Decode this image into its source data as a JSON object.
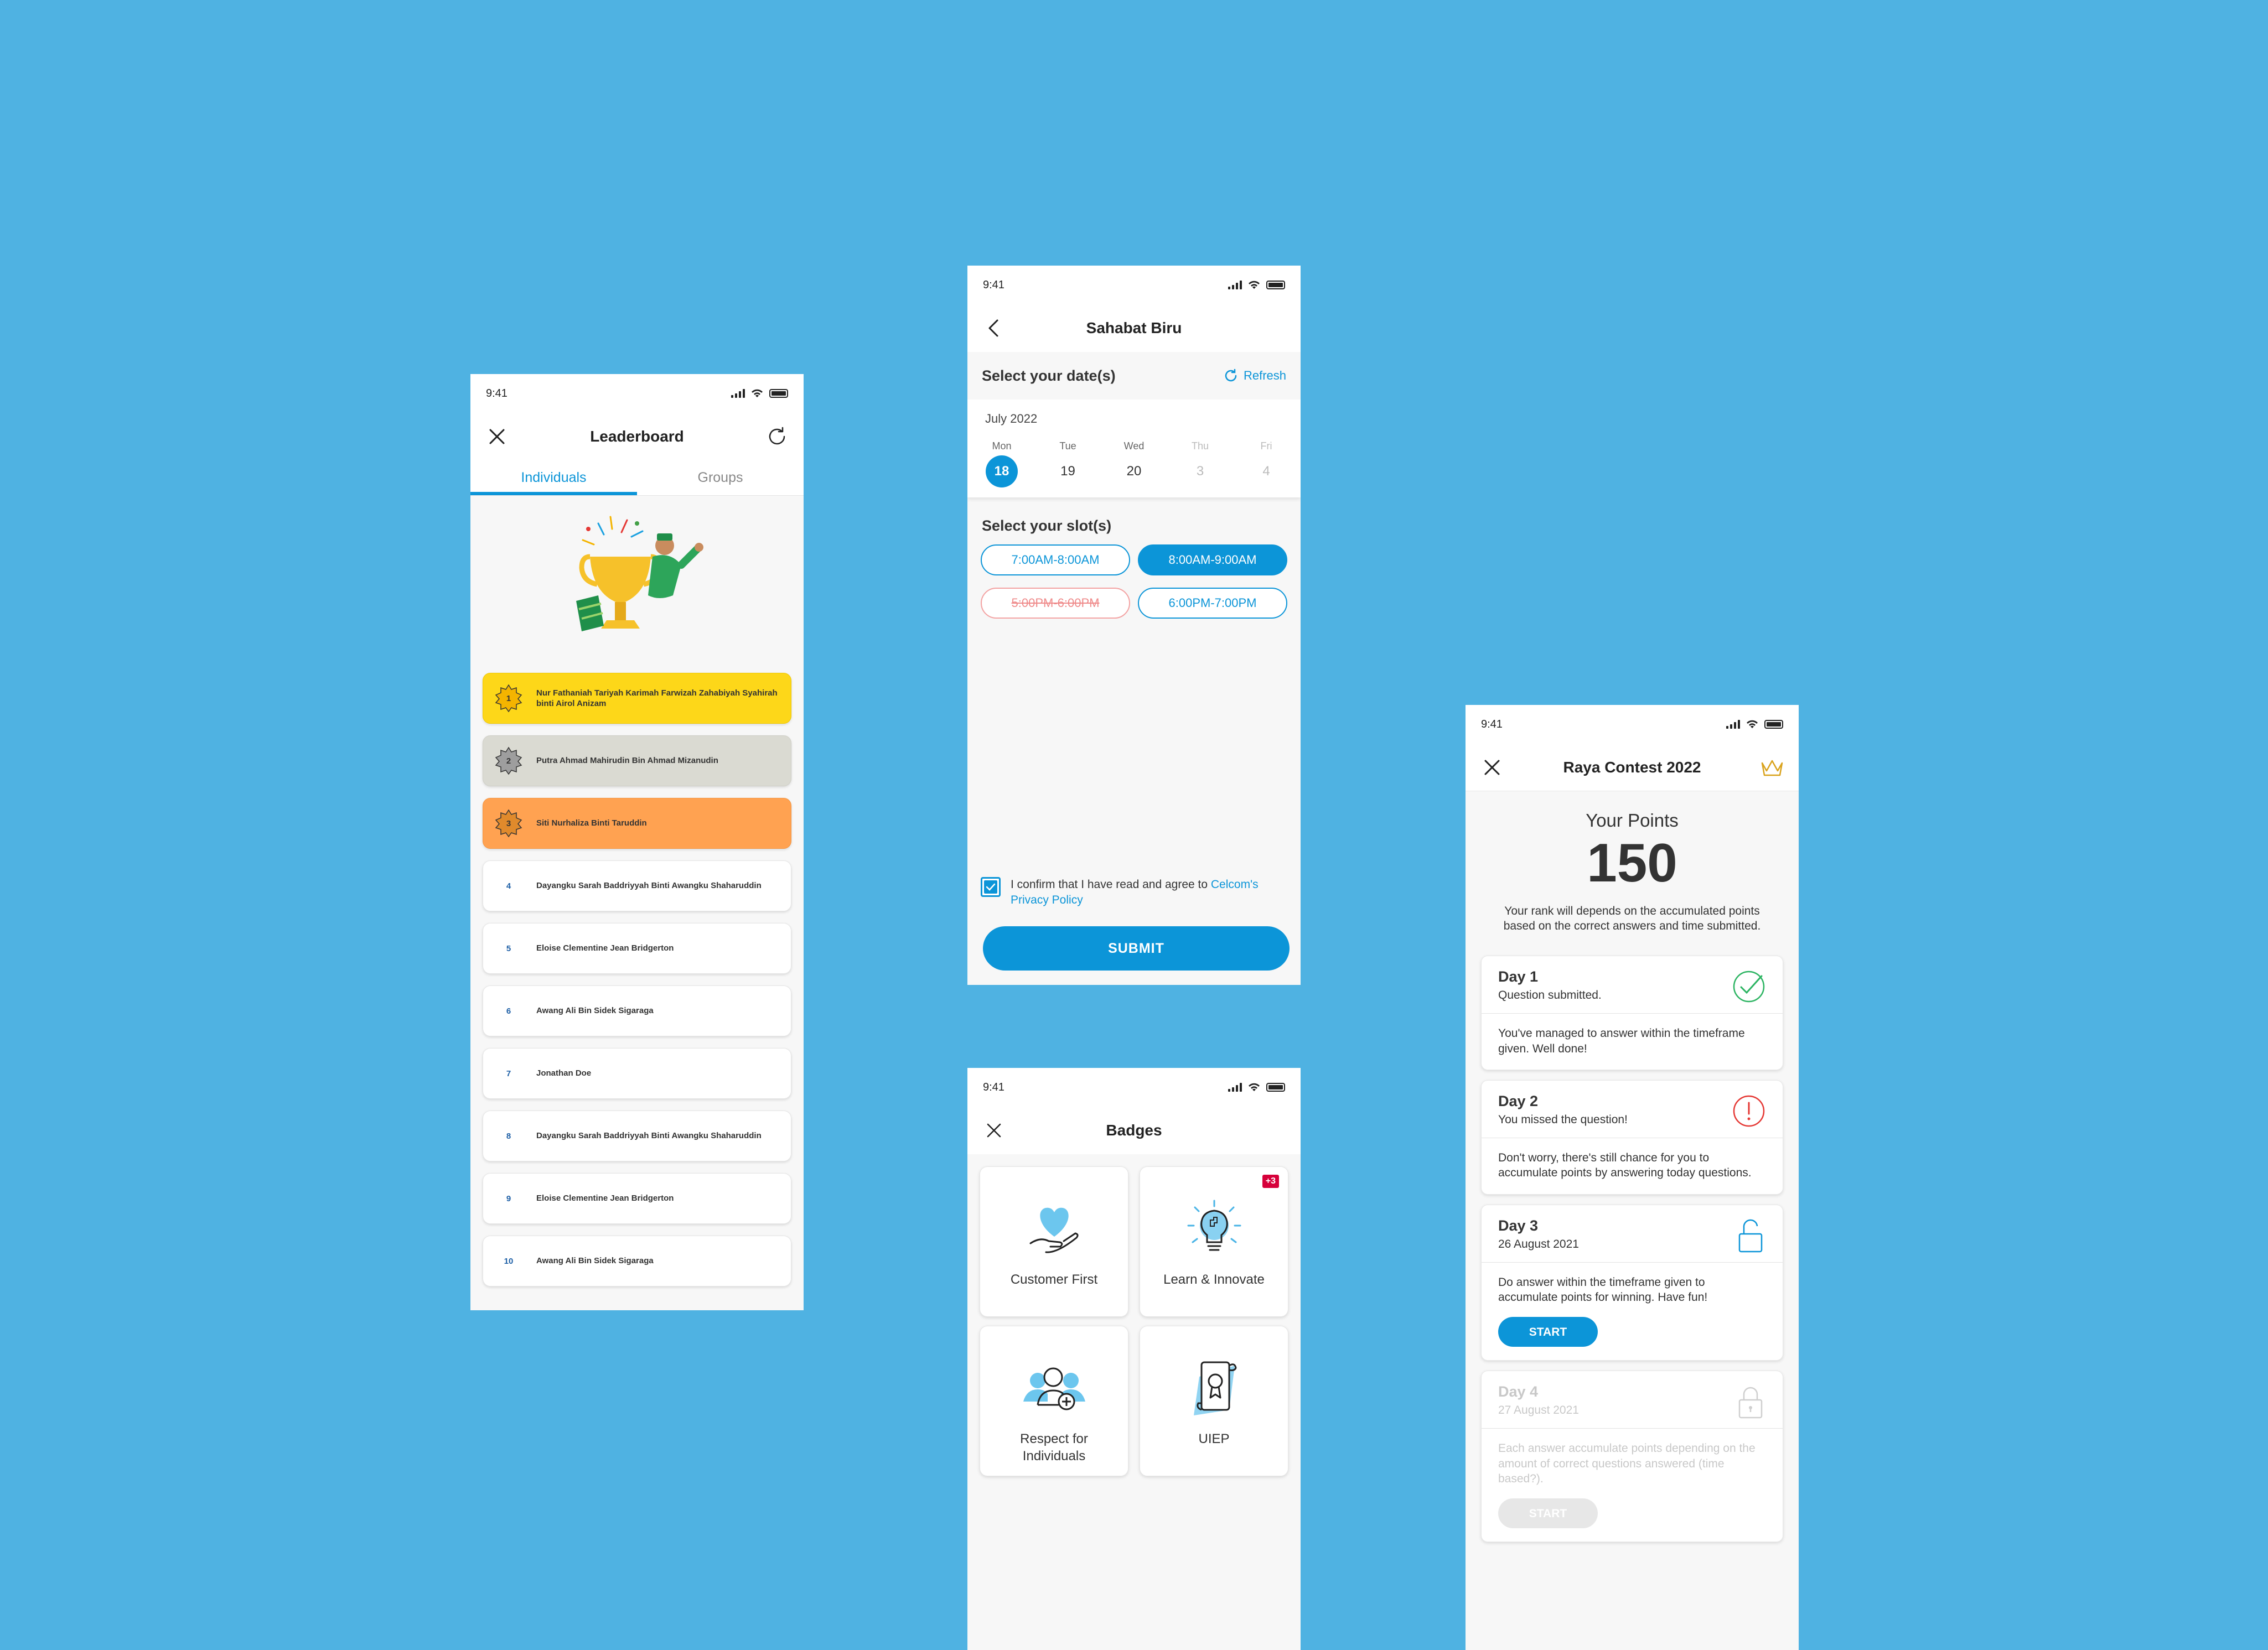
{
  "status": {
    "time": "9:41"
  },
  "leaderboard": {
    "title": "Leaderboard",
    "tabs": [
      "Individuals",
      "Groups"
    ],
    "rows": [
      {
        "rank": "1",
        "name": "Nur Fathaniah Tariyah Karimah Farwizah Zahabiyah Syahirah binti Airol Anizam"
      },
      {
        "rank": "2",
        "name": "Putra Ahmad Mahirudin Bin Ahmad Mizanudin"
      },
      {
        "rank": "3",
        "name": "Siti Nurhaliza Binti Taruddin"
      },
      {
        "rank": "4",
        "name": "Dayangku Sarah Baddriyyah Binti Awangku Shaharuddin"
      },
      {
        "rank": "5",
        "name": "Eloise Clementine Jean Bridgerton"
      },
      {
        "rank": "6",
        "name": "Awang Ali Bin Sidek Sigaraga"
      },
      {
        "rank": "7",
        "name": "Jonathan Doe"
      },
      {
        "rank": "8",
        "name": "Dayangku Sarah Baddriyyah Binti Awangku Shaharuddin"
      },
      {
        "rank": "9",
        "name": "Eloise Clementine Jean Bridgerton"
      },
      {
        "rank": "10",
        "name": "Awang Ali Bin Sidek Sigaraga"
      }
    ]
  },
  "sahabat": {
    "title": "Sahabat Biru",
    "select_dates": "Select your date(s)",
    "refresh": "Refresh",
    "month": "July 2022",
    "days": [
      {
        "name": "Mon",
        "date": "18"
      },
      {
        "name": "Tue",
        "date": "19"
      },
      {
        "name": "Wed",
        "date": "20"
      },
      {
        "name": "Thu",
        "date": "3"
      },
      {
        "name": "Fri",
        "date": "4"
      }
    ],
    "select_slots": "Select your slot(s)",
    "slots": [
      "7:00AM-8:00AM",
      "8:00AM-9:00AM",
      "5:00PM-6:00PM",
      "6:00PM-7:00PM"
    ],
    "confirm_text": "I confirm that I have read and agree to ",
    "confirm_link": "Celcom's Privacy Policy",
    "submit": "SUBMIT",
    "colors": {
      "primary": "#0C95D8",
      "unavailable": "#EF8B8B"
    }
  },
  "badges": {
    "title": "Badges",
    "items": [
      {
        "label": "Customer First",
        "icon": "heart-hand-icon"
      },
      {
        "label": "Learn & Innovate",
        "icon": "lightbulb-puzzle-icon",
        "count": "+3"
      },
      {
        "label": "Respect for Individuals",
        "icon": "people-add-icon"
      },
      {
        "label": "UIEP",
        "icon": "certificate-scroll-icon"
      }
    ]
  },
  "raya": {
    "title": "Raya Contest 2022",
    "points_label": "Your Points",
    "points_value": "150",
    "points_desc": "Your rank will depends on the accumulated points based on the correct answers and time submitted.",
    "days": [
      {
        "title": "Day 1",
        "sub": "Question submitted.",
        "body": "You've managed to answer within the timeframe given. Well done!",
        "state": "done"
      },
      {
        "title": "Day 2",
        "sub": "You missed the question!",
        "body": "Don't worry, there's still chance for you to accumulate points by answering today questions.",
        "state": "missed"
      },
      {
        "title": "Day 3",
        "sub": "26 August 2021",
        "body": "Do answer within the timeframe given to accumulate points for winning. Have fun!",
        "state": "open",
        "button": "START"
      },
      {
        "title": "Day 4",
        "sub": "27 August 2021",
        "body": "Each answer accumulate points depending on the amount of correct questions answered (time based?).",
        "state": "locked",
        "button": "START"
      }
    ]
  }
}
